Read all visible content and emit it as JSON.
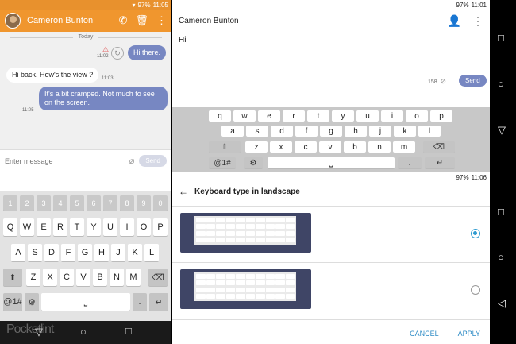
{
  "left": {
    "status": {
      "battery": "97%",
      "time": "11:05"
    },
    "contact": "Cameron Bunton",
    "day_divider": "Today",
    "messages": [
      {
        "dir": "out",
        "text": "Hi there.",
        "time": "11:02"
      },
      {
        "dir": "in",
        "text": "Hi back. How's the view ?",
        "time": "11:03"
      },
      {
        "dir": "out",
        "text": "It's a bit cramped. Not much to see on the screen.",
        "time": "11:05"
      }
    ],
    "composer": {
      "placeholder": "Enter message",
      "send": "Send"
    },
    "keyboard": {
      "numbers": [
        "1",
        "2",
        "3",
        "4",
        "5",
        "6",
        "7",
        "8",
        "9",
        "0"
      ],
      "row1": [
        "Q",
        "W",
        "E",
        "R",
        "T",
        "Y",
        "U",
        "I",
        "O",
        "P"
      ],
      "row2": [
        "A",
        "S",
        "D",
        "F",
        "G",
        "H",
        "J",
        "K",
        "L"
      ],
      "row3": [
        "Z",
        "X",
        "C",
        "V",
        "B",
        "N",
        "M"
      ],
      "sym": "@1#"
    },
    "watermark": "Pocketlint"
  },
  "top_right": {
    "status": {
      "battery": "97%",
      "time": "11:01"
    },
    "contact": "Cameron Bunton",
    "message": "Hi",
    "char_count": "158",
    "send": "Send",
    "keyboard": {
      "row1": [
        "q",
        "w",
        "e",
        "r",
        "t",
        "y",
        "u",
        "i",
        "o",
        "p"
      ],
      "row2": [
        "a",
        "s",
        "d",
        "f",
        "g",
        "h",
        "j",
        "k",
        "l"
      ],
      "row3": [
        "z",
        "x",
        "c",
        "v",
        "b",
        "n",
        "m"
      ],
      "sym": "@1#"
    }
  },
  "bottom_right": {
    "status": {
      "battery": "97%",
      "time": "11:06"
    },
    "title": "Keyboard type in landscape",
    "cancel": "CANCEL",
    "apply": "APPLY"
  },
  "colors": {
    "accent": "#f0962e",
    "bubble": "#7787c2",
    "radio": "#2f9bd0"
  }
}
